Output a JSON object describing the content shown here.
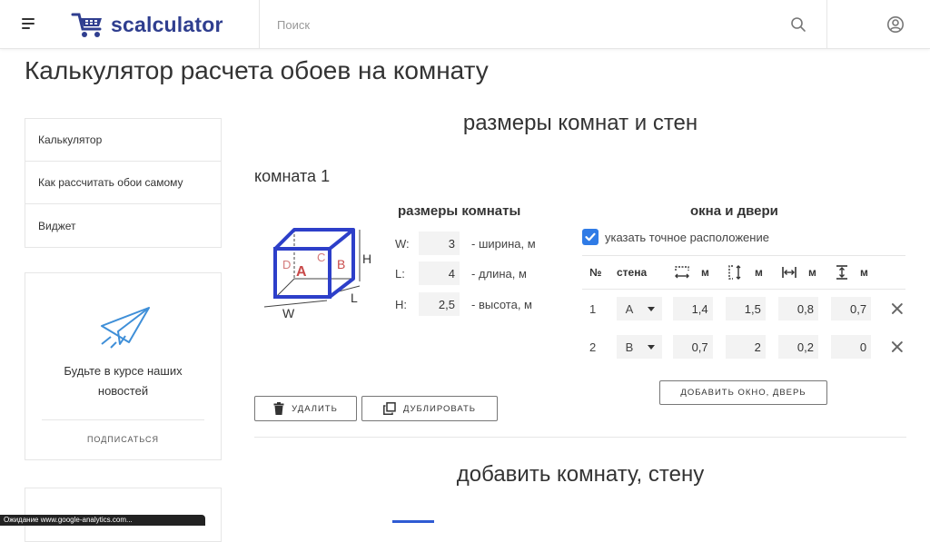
{
  "header": {
    "logo_text": "scalculator",
    "search_placeholder": "Поиск"
  },
  "page_title": "Калькулятор расчета обоев на комнату",
  "sidebar": {
    "items": [
      {
        "label": "Калькулятор"
      },
      {
        "label": "Как рассчитать обои самому"
      },
      {
        "label": "Виджет"
      }
    ],
    "news_line1": "Будьте в курсе наших",
    "news_line2": "новостей",
    "subscribe_label": "ПОДПИСАТЬСЯ"
  },
  "status_text": "Ожидание www.google-analytics.com...",
  "sections": {
    "rooms_title": "размеры комнат и стен",
    "add_room_title": "добавить комнату, стену"
  },
  "room": {
    "title": "комната 1",
    "diagram_labels": {
      "a": "A",
      "b": "B",
      "c": "C",
      "d": "D",
      "h": "H",
      "l": "L",
      "w": "W"
    },
    "dims_title": "размеры комнаты",
    "dims": [
      {
        "label": "W:",
        "value": "3",
        "unit": "- ширина, м"
      },
      {
        "label": "L:",
        "value": "4",
        "unit": "- длина, м"
      },
      {
        "label": "H:",
        "value": "2,5",
        "unit": "- высота, м"
      }
    ],
    "delete_label": "УДАЛИТЬ",
    "duplicate_label": "ДУБЛИРОВАТЬ"
  },
  "windows_doors": {
    "title": "окна и двери",
    "exact_position_label": "указать точное расположение",
    "exact_position_checked": true,
    "headers": {
      "num": "№",
      "wall": "стена",
      "unit": "м"
    },
    "rows": [
      {
        "num": "1",
        "wall": "A",
        "width": "1,4",
        "height": "1,5",
        "offset_x": "0,8",
        "offset_y": "0,7"
      },
      {
        "num": "2",
        "wall": "B",
        "width": "0,7",
        "height": "2",
        "offset_x": "0,2",
        "offset_y": "0"
      }
    ],
    "add_label": "ДОБАВИТЬ ОКНО, ДВЕРЬ"
  },
  "colors": {
    "brand": "#2f3e8f",
    "accent": "#2f7be6",
    "room_diagram": "#2d3fc9",
    "wall_letters": "#c94a4a"
  }
}
